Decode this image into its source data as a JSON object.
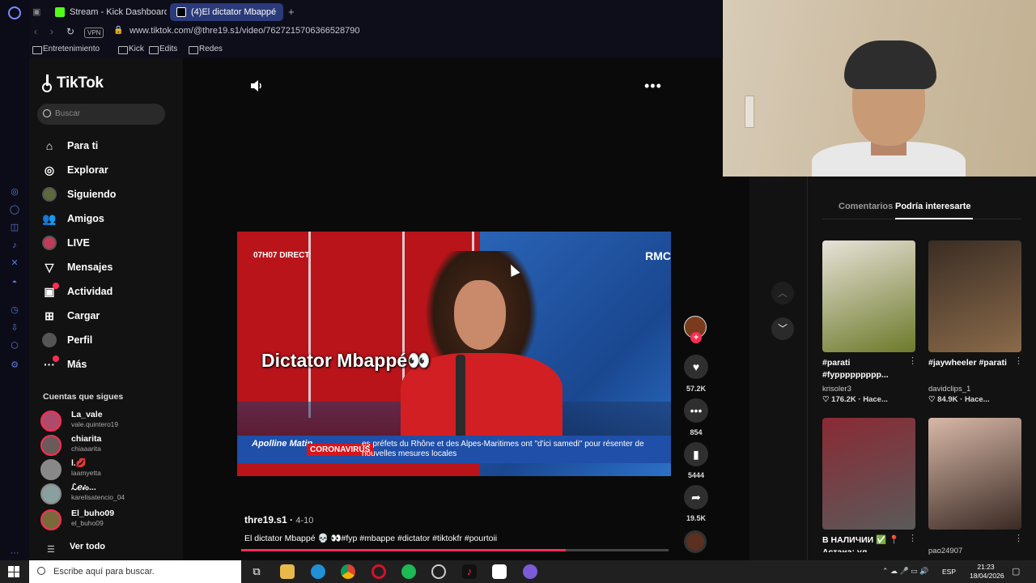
{
  "browser": {
    "tabs": [
      {
        "label": "Stream - Kick Dashboard",
        "fav_color": "#53fc18"
      },
      {
        "label": "(4)El dictator Mbappé",
        "fav_color": "#ffffff"
      }
    ],
    "new_tab_label": "+",
    "vpn_label": "VPN",
    "url": "www.tiktok.com/@thre19.s1/video/7627215706366528790",
    "bookmarks": [
      "Entretenimiento",
      "Kick",
      "Edits",
      "Redes"
    ]
  },
  "tiktok": {
    "logo": "TikTok",
    "search_placeholder": "Buscar",
    "nav": [
      {
        "label": "Para ti",
        "icon": "home-icon",
        "glyph": "⌂"
      },
      {
        "label": "Explorar",
        "icon": "compass-icon",
        "glyph": "◎"
      },
      {
        "label": "Siguiendo",
        "icon": "following-avatar",
        "glyph": ""
      },
      {
        "label": "Amigos",
        "icon": "friends-icon",
        "glyph": "👥"
      },
      {
        "label": "LIVE",
        "icon": "live-avatar",
        "glyph": ""
      },
      {
        "label": "Mensajes",
        "icon": "send-icon",
        "glyph": "▽"
      },
      {
        "label": "Actividad",
        "icon": "activity-icon",
        "glyph": "▣"
      },
      {
        "label": "Cargar",
        "icon": "upload-icon",
        "glyph": "⊞"
      },
      {
        "label": "Perfil",
        "icon": "profile-avatar",
        "glyph": ""
      },
      {
        "label": "Más",
        "icon": "more-icon",
        "glyph": "···"
      }
    ],
    "following_title": "Cuentas que sigues",
    "following": [
      {
        "name": "La_vale",
        "handle": "vale.quintero19"
      },
      {
        "name": "chiarita",
        "handle": "chiaaarita"
      },
      {
        "name": "l.💋",
        "handle": "laamyetta"
      },
      {
        "name": "ℒℯ𝒾ℴ...",
        "handle": "karelisatencio_04"
      },
      {
        "name": "El_buho09",
        "handle": "el_buho09"
      }
    ],
    "see_all": "Ver todo"
  },
  "video": {
    "timestamp_overlay": "07H07  DIRECT",
    "channel_overlay": "RMC",
    "caption_overlay": "Dictator Mbappé👀",
    "ticker_logo": "Apolline Matin",
    "ticker_tag": "CORONAVIRUS",
    "ticker_text": "es préfets du Rhône et des Alpes-Maritimes ont \"d'ici samedi\" pour résenter de nouvelles mesures locales",
    "author": "thre19.s1",
    "date": "4-10",
    "description": "El dictator Mbappé 💀 👀#fyp #mbappe #dictator #tiktokfr #pourtoii",
    "progress": 0.76,
    "likes": "57.2K",
    "comments": "854",
    "saves": "5444",
    "shares": "19.5K"
  },
  "right_panel": {
    "tab_comments": "Comentarios",
    "tab_suggest": "Podría interesarte",
    "items": [
      {
        "title": "#parati #fyppppppppp...",
        "user": "krisoler3",
        "meta": "♡ 176.2K · Hace...",
        "colors": [
          "#e8e2d8",
          "#6d7a2a"
        ]
      },
      {
        "title": "#jaywheeler #parati",
        "user": "davidclips_1",
        "meta": "♡ 84.9K · Hace...",
        "colors": [
          "#3a2d24",
          "#8a6a4a"
        ]
      },
      {
        "title": "В НАЛИЧИИ ✅ 📍 Астана: ул...",
        "user": "",
        "meta": "",
        "colors": [
          "#8a2a34",
          "#5a5a5a"
        ]
      },
      {
        "title": "",
        "user": "pao24907",
        "meta": "",
        "colors": [
          "#d8b8a8",
          "#3a2a24"
        ]
      }
    ]
  },
  "taskbar": {
    "search_placeholder": "Escribe aquí para buscar.",
    "lang": "ESP",
    "time": "21:23",
    "date": "18/04/2026"
  }
}
